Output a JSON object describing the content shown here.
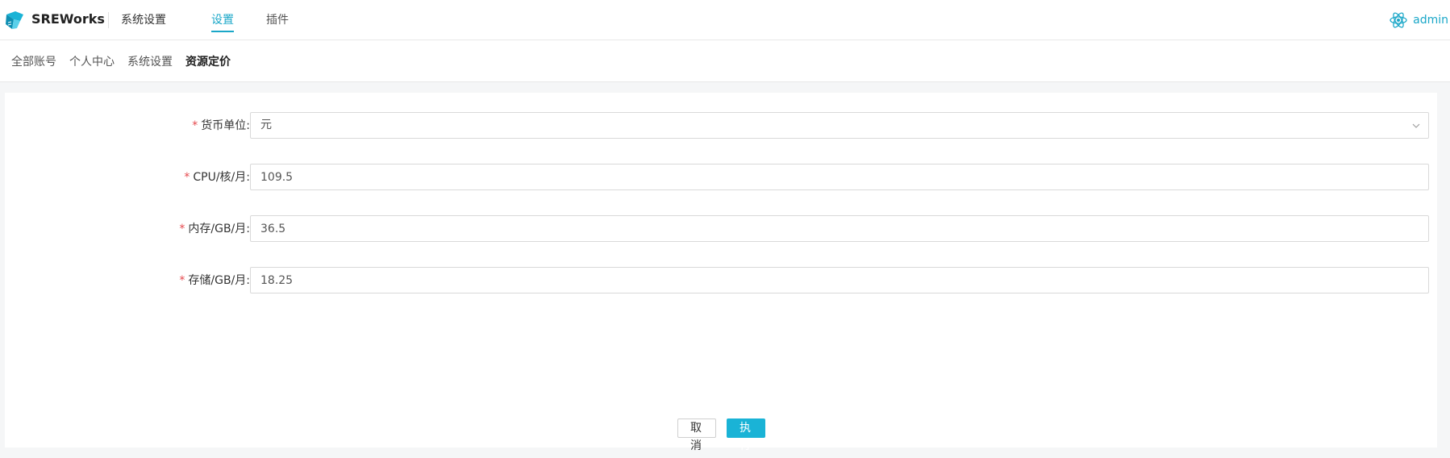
{
  "header": {
    "brand": "SREWorks",
    "app_title": "系统设置",
    "tabs": [
      {
        "label": "设置",
        "active": true
      },
      {
        "label": "插件",
        "active": false
      }
    ],
    "user": {
      "name": "admin",
      "icon": "react-atom-icon"
    },
    "accent_color": "#1aa7c8"
  },
  "subnav": {
    "items": [
      {
        "label": "全部账号",
        "active": false
      },
      {
        "label": "个人中心",
        "active": false
      },
      {
        "label": "系统设置",
        "active": false
      },
      {
        "label": "资源定价",
        "active": true
      }
    ]
  },
  "form": {
    "fields": [
      {
        "label": "货币单位:",
        "required": true,
        "type": "select",
        "value": "元"
      },
      {
        "label": "CPU/核/月:",
        "required": true,
        "type": "text",
        "value": "109.5"
      },
      {
        "label": "内存/GB/月:",
        "required": true,
        "type": "text",
        "value": "36.5"
      },
      {
        "label": "存储/GB/月:",
        "required": true,
        "type": "text",
        "value": "18.25"
      }
    ],
    "cancel_label": "取消",
    "submit_label": "执行"
  }
}
